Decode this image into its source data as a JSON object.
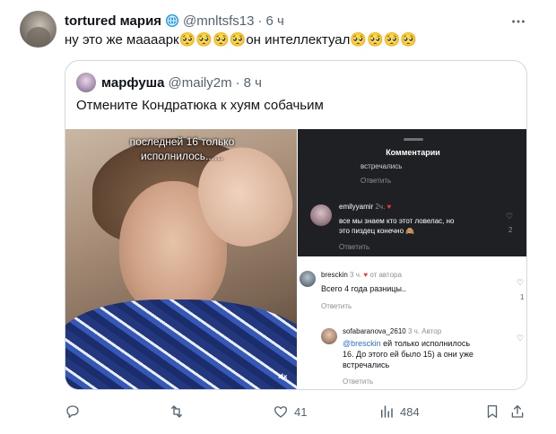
{
  "tweet": {
    "author_name": "tortured мария",
    "handle": "@mnltsfs13",
    "separator": "·",
    "time": "6 ч",
    "text": "ну это же маааарк🥺🥺🥺🥺он интеллектуал🥺🥺🥺🥺"
  },
  "quote": {
    "author_name": "марфуша",
    "handle": "@maily2m",
    "separator": "·",
    "time": "8 ч",
    "text": "Отмените Кондратюка к хуям собачьим"
  },
  "media": {
    "video_overlay_text_1": "последней 16 только",
    "video_overlay_text_2": "исполнилось......",
    "screenshot": {
      "title": "Комментарии",
      "prev_line": "встречались",
      "prev_reply": "Ответить",
      "comments": [
        {
          "user": "emilyyamir",
          "age": "2ч.",
          "text_1": "все мы знаем кто этот ловелас, но",
          "text_2": "это пиздец конечно 🙈",
          "reply": "Ответить",
          "likes": "2"
        },
        {
          "user": "bresckin",
          "age": "3 ч.",
          "badge": "от автора",
          "text_1": "Всего 4 года разницы..",
          "reply": "Ответить",
          "likes": "1"
        },
        {
          "user": "sofabaranova_2610",
          "age": "3 ч.",
          "badge": "Автор",
          "mention": "@bresckin",
          "text_1": " ей только исполнилось",
          "text_2": "16. До этого ей было 15) а они уже",
          "text_3": "встречались",
          "reply": "Ответить"
        }
      ]
    }
  },
  "actions": {
    "reply_count": "",
    "retweet_count": "",
    "like_count": "41",
    "views_count": "484"
  },
  "icons": [
    "verified-badge-icon",
    "more-icon",
    "reply-icon",
    "retweet-icon",
    "like-icon",
    "views-icon",
    "bookmark-icon",
    "share-icon",
    "mute-icon",
    "heart-icon"
  ]
}
